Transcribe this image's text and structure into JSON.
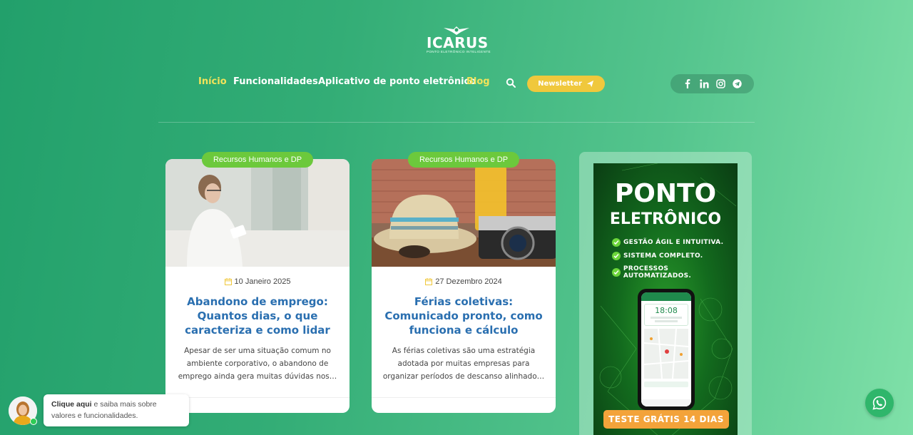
{
  "brand": {
    "name": "ICARUS",
    "tagline": "PONTO ELETRÔNICO INTELIGENTE"
  },
  "nav": {
    "items": [
      {
        "label": "Início"
      },
      {
        "label": "Funcionalidades"
      },
      {
        "label": "Aplicativo de ponto eletrônico"
      },
      {
        "label": "Blog"
      }
    ],
    "search_icon": "search-icon",
    "newsletter_label": "Newsletter"
  },
  "social": [
    "facebook-icon",
    "linkedin-icon",
    "instagram-icon",
    "telegram-icon"
  ],
  "posts": [
    {
      "category": "Recursos Humanos e DP",
      "date": "10 Janeiro 2025",
      "title": "Abandono de emprego: Quantos dias, o que caracteriza e como lidar",
      "excerpt": "Apesar de ser uma situação comum no ambiente corporativo, o abandono de emprego ainda gera muitas dúvidas nos…"
    },
    {
      "category": "Recursos Humanos e DP",
      "date": "27 Dezembro 2024",
      "title": "Férias coletivas: Comunicado pronto, como funciona e cálculo",
      "excerpt": "As férias coletivas são uma estratégia adotada por muitas empresas para organizar períodos de descanso alinhado…"
    }
  ],
  "ad": {
    "line1": "PONTO",
    "line2": "ELETRÔNICO",
    "bullets": [
      "GESTÃO ÁGIL E INTUITIVA.",
      "SISTEMA COMPLETO.",
      "PROCESSOS AUTOMATIZADOS."
    ],
    "phone_time": "18:08",
    "cta": "TESTE GRÁTIS 14 DIAS"
  },
  "chat": {
    "strong": "Clique aqui",
    "rest1": " e saiba mais sobre",
    "rest2": "valores e funcionalidades."
  },
  "colors": {
    "accent_yellow": "#f2e35a",
    "category_green": "#6cc93c",
    "title_blue": "#2a6fb0",
    "cta_orange": "#f3a33a"
  }
}
